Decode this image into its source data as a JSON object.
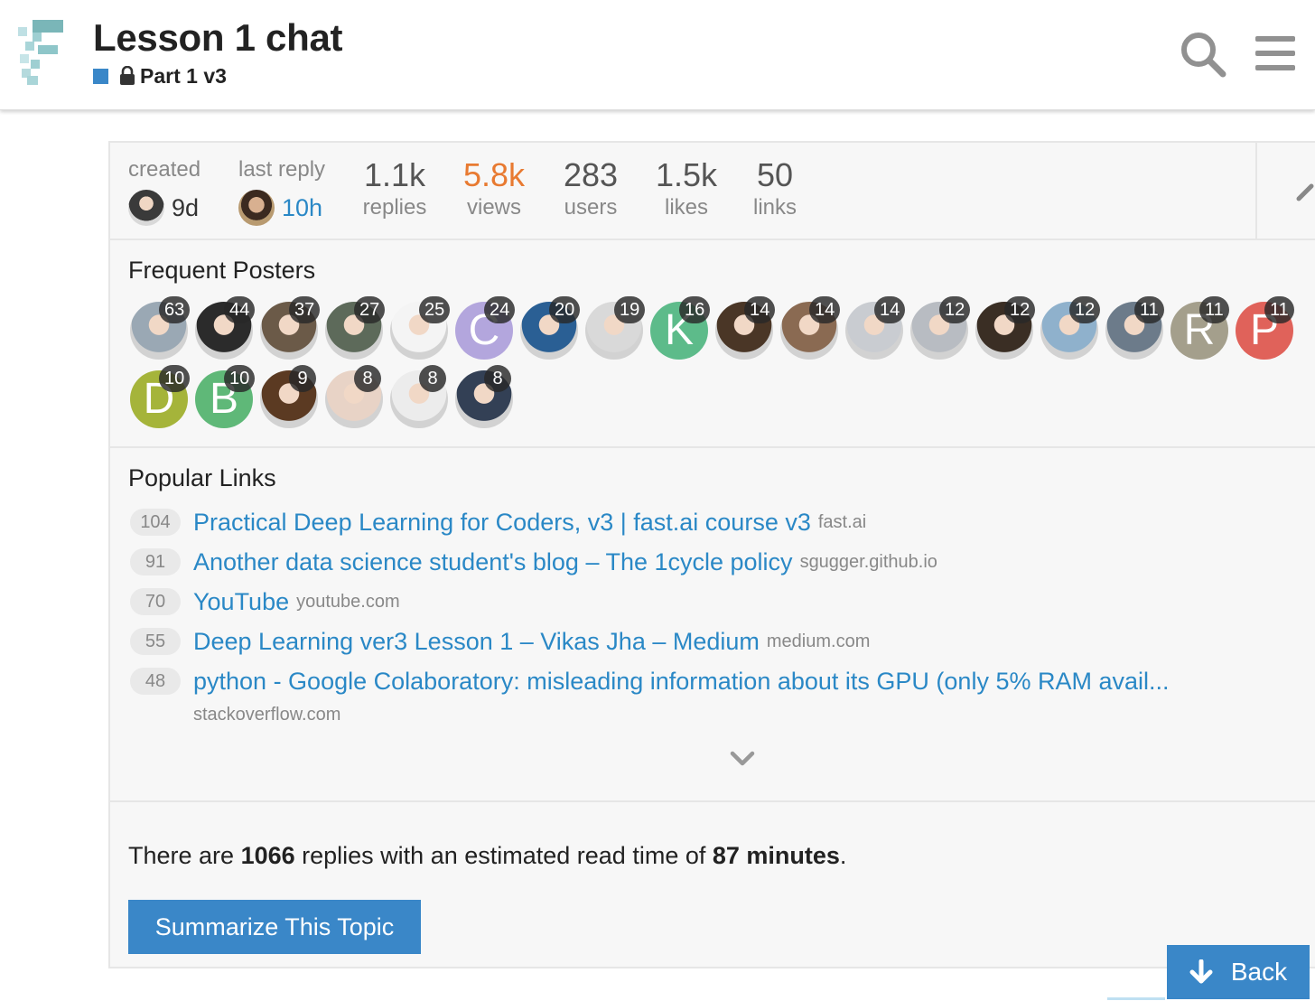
{
  "header": {
    "title": "Lesson 1 chat",
    "category": "Part 1 v3",
    "category_color": "#3a87c8"
  },
  "topic_map": {
    "created": {
      "label": "created",
      "value": "9d"
    },
    "last_reply": {
      "label": "last reply",
      "value": "10h"
    },
    "stats": [
      {
        "num": "1.1k",
        "label": "replies"
      },
      {
        "num": "5.8k",
        "label": "views"
      },
      {
        "num": "283",
        "label": "users"
      },
      {
        "num": "1.5k",
        "label": "likes"
      },
      {
        "num": "50",
        "label": "links"
      }
    ],
    "views_color": "#e87a31"
  },
  "frequent_posters": {
    "title": "Frequent Posters",
    "posters": [
      {
        "count": "63",
        "letter": "",
        "color": "#9aa8b4"
      },
      {
        "count": "44",
        "letter": "",
        "color": "#2b2b2b"
      },
      {
        "count": "37",
        "letter": "",
        "color": "#6b5a48"
      },
      {
        "count": "27",
        "letter": "",
        "color": "#5d6a5a"
      },
      {
        "count": "25",
        "letter": "",
        "color": "#f4f4f4"
      },
      {
        "count": "24",
        "letter": "C",
        "color": "#b3a6dd"
      },
      {
        "count": "20",
        "letter": "",
        "color": "#2a5f94"
      },
      {
        "count": "19",
        "letter": "",
        "color": "#d9d9d9"
      },
      {
        "count": "16",
        "letter": "K",
        "color": "#5dbb8a"
      },
      {
        "count": "14",
        "letter": "",
        "color": "#4a3626"
      },
      {
        "count": "14",
        "letter": "",
        "color": "#8a6a52"
      },
      {
        "count": "14",
        "letter": "",
        "color": "#c9ccd1"
      },
      {
        "count": "12",
        "letter": "",
        "color": "#b8bcc2"
      },
      {
        "count": "12",
        "letter": "",
        "color": "#3a2e24"
      },
      {
        "count": "12",
        "letter": "",
        "color": "#8fb1cc"
      },
      {
        "count": "11",
        "letter": "",
        "color": "#6c7b8a"
      },
      {
        "count": "11",
        "letter": "R",
        "color": "#a49f8c"
      },
      {
        "count": "11",
        "letter": "P",
        "color": "#e0625a"
      },
      {
        "count": "10",
        "letter": "D",
        "color": "#a5b43a"
      },
      {
        "count": "10",
        "letter": "B",
        "color": "#5fb878"
      },
      {
        "count": "9",
        "letter": "",
        "color": "#5b3a22"
      },
      {
        "count": "8",
        "letter": "",
        "color": "#e8d3c6"
      },
      {
        "count": "8",
        "letter": "",
        "color": "#ececec"
      },
      {
        "count": "8",
        "letter": "",
        "color": "#334055"
      }
    ]
  },
  "popular_links": {
    "title": "Popular Links",
    "links": [
      {
        "clicks": "104",
        "title": "Practical Deep Learning for Coders, v3 | fast.ai course v3",
        "domain": "fast.ai"
      },
      {
        "clicks": "91",
        "title": "Another data science student's blog – The 1cycle policy",
        "domain": "sgugger.github.io"
      },
      {
        "clicks": "70",
        "title": "YouTube",
        "domain": "youtube.com"
      },
      {
        "clicks": "55",
        "title": "Deep Learning ver3 Lesson 1 – Vikas Jha – Medium",
        "domain": "medium.com"
      },
      {
        "clicks": "48",
        "title": "python - Google Colaboratory: misleading information about its GPU (only 5% RAM avail...",
        "domain": "stackoverflow.com"
      }
    ]
  },
  "summary": {
    "pre": "There are ",
    "replies": "1066",
    "mid": " replies with an estimated read time of ",
    "minutes": "87 minutes",
    "post": ".",
    "button": "Summarize This Topic"
  },
  "back_button": "Back"
}
